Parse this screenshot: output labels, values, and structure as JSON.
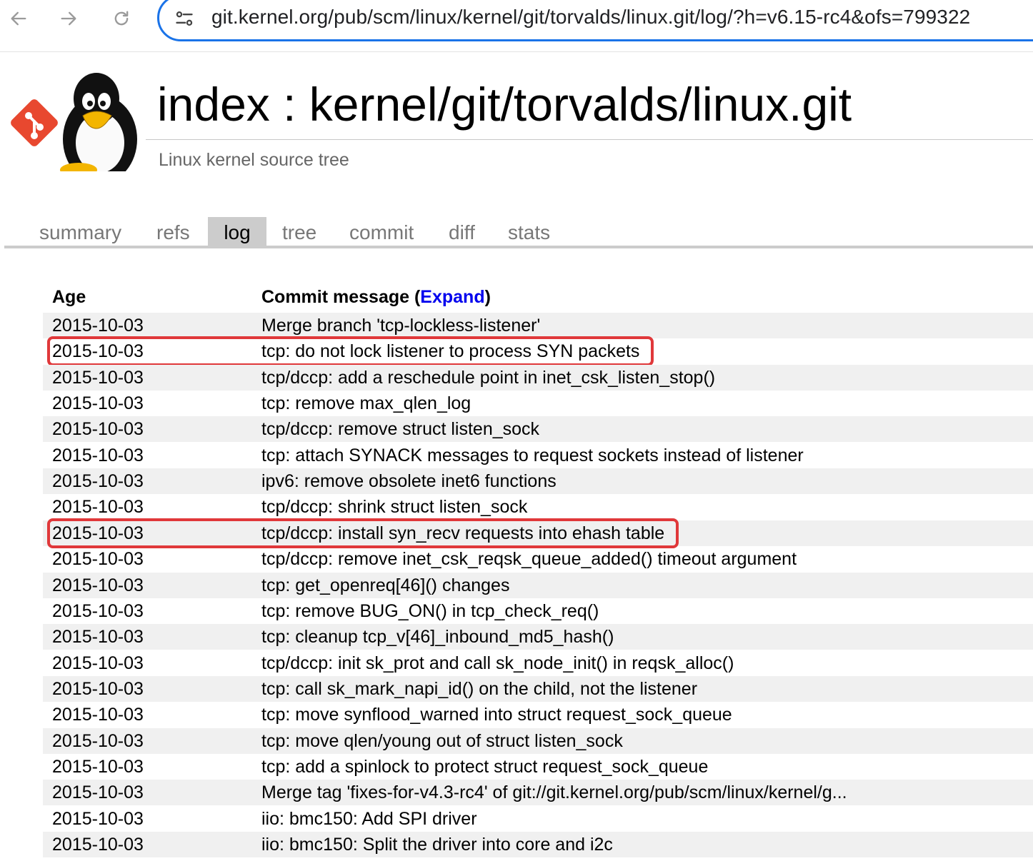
{
  "browser": {
    "url": "git.kernel.org/pub/scm/linux/kernel/git/torvalds/linux.git/log/?h=v6.15-rc4&ofs=799322",
    "icons": {
      "back": "arrow-left-icon",
      "forward": "arrow-right-icon",
      "reload": "reload-icon",
      "site_info": "tune-icon"
    }
  },
  "header": {
    "title": "index : kernel/git/torvalds/linux.git",
    "description": "Linux kernel source tree"
  },
  "tabs": [
    {
      "label": "summary"
    },
    {
      "label": "refs"
    },
    {
      "label": "log",
      "active": true
    },
    {
      "label": "tree"
    },
    {
      "label": "commit"
    },
    {
      "label": "diff"
    },
    {
      "label": "stats"
    }
  ],
  "log": {
    "age_header": "Age",
    "msg_header": "Commit message (",
    "expand_label": "Expand",
    "msg_header_close": ")",
    "rows": [
      {
        "age": "2015-10-03",
        "message": "Merge branch 'tcp-lockless-listener'"
      },
      {
        "age": "2015-10-03",
        "message": "tcp: do not lock listener to process SYN packets",
        "highlighted": true
      },
      {
        "age": "2015-10-03",
        "message": "tcp/dccp: add a reschedule point in inet_csk_listen_stop()"
      },
      {
        "age": "2015-10-03",
        "message": "tcp: remove max_qlen_log"
      },
      {
        "age": "2015-10-03",
        "message": "tcp/dccp: remove struct listen_sock"
      },
      {
        "age": "2015-10-03",
        "message": "tcp: attach SYNACK messages to request sockets instead of listener"
      },
      {
        "age": "2015-10-03",
        "message": "ipv6: remove obsolete inet6 functions"
      },
      {
        "age": "2015-10-03",
        "message": "tcp/dccp: shrink struct listen_sock"
      },
      {
        "age": "2015-10-03",
        "message": "tcp/dccp: install syn_recv requests into ehash table",
        "highlighted": true
      },
      {
        "age": "2015-10-03",
        "message": "tcp/dccp: remove inet_csk_reqsk_queue_added() timeout argument"
      },
      {
        "age": "2015-10-03",
        "message": "tcp: get_openreq[46]() changes"
      },
      {
        "age": "2015-10-03",
        "message": "tcp: remove BUG_ON() in tcp_check_req()"
      },
      {
        "age": "2015-10-03",
        "message": "tcp: cleanup tcp_v[46]_inbound_md5_hash()"
      },
      {
        "age": "2015-10-03",
        "message": "tcp/dccp: init sk_prot and call sk_node_init() in reqsk_alloc()"
      },
      {
        "age": "2015-10-03",
        "message": "tcp: call sk_mark_napi_id() on the child, not the listener"
      },
      {
        "age": "2015-10-03",
        "message": "tcp: move synflood_warned into struct request_sock_queue"
      },
      {
        "age": "2015-10-03",
        "message": "tcp: move qlen/young out of struct listen_sock"
      },
      {
        "age": "2015-10-03",
        "message": "tcp: add a spinlock to protect struct request_sock_queue"
      },
      {
        "age": "2015-10-03",
        "message": "Merge tag 'fixes-for-v4.3-rc4' of git://git.kernel.org/pub/scm/linux/kernel/g..."
      },
      {
        "age": "2015-10-03",
        "message": "iio: bmc150: Add SPI driver"
      },
      {
        "age": "2015-10-03",
        "message": "iio: bmc150: Split the driver into core and i2c"
      }
    ]
  },
  "colors": {
    "highlight": "#e0383a",
    "link": "#0000ee",
    "omnibox_border": "#1a73e8"
  }
}
